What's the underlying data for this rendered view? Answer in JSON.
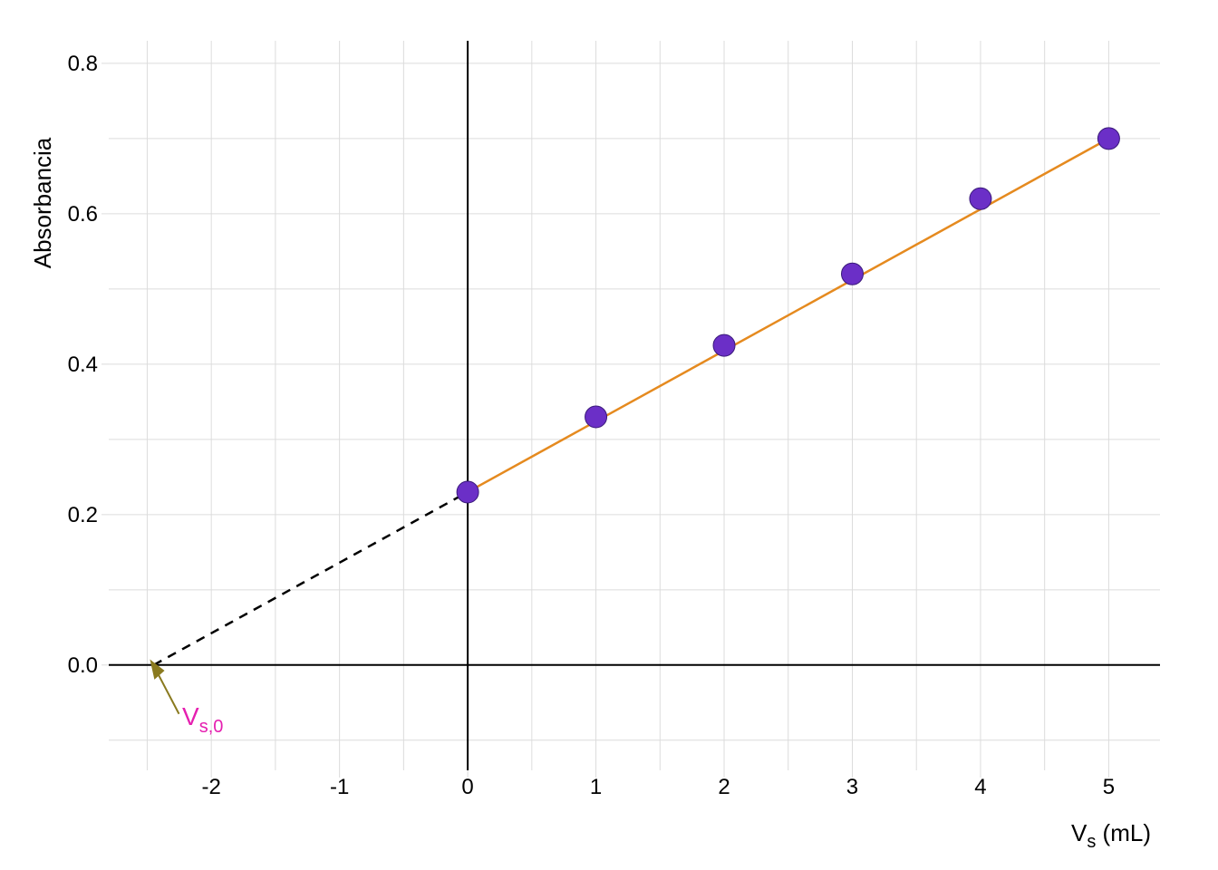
{
  "chart_data": {
    "type": "scatter",
    "title": "",
    "xlabel": "Vₛ  (mL)",
    "ylabel": "Absorbancia",
    "xlim": [
      -2.8,
      5.4
    ],
    "ylim": [
      -0.14,
      0.83
    ],
    "x_ticks": [
      -2,
      -1,
      0,
      1,
      2,
      3,
      4,
      5
    ],
    "y_ticks": [
      0.0,
      0.2,
      0.4,
      0.6,
      0.8
    ],
    "series": [
      {
        "name": "data",
        "x": [
          0,
          1,
          2,
          3,
          4,
          5
        ],
        "y": [
          0.23,
          0.33,
          0.425,
          0.52,
          0.62,
          0.7
        ]
      },
      {
        "name": "fit_line",
        "x": [
          0,
          5
        ],
        "y": [
          0.23,
          0.7
        ]
      },
      {
        "name": "extrapolation",
        "x": [
          -2.45,
          0
        ],
        "y": [
          0,
          0.23
        ]
      }
    ],
    "annotations": [
      {
        "id": "vs0",
        "text_main": "V",
        "text_sub": "s,0",
        "arrow_from": [
          -2.25,
          -0.065
        ],
        "arrow_to": [
          -2.42,
          -0.005
        ]
      }
    ],
    "colors": {
      "grid": "#dcdcdc",
      "point_fill": "#6b2fc7",
      "fit_line": "#e58a1f",
      "extrap": "#000000",
      "annotation_arrow": "#8a7a1f",
      "annotation_text": "#e51fb0"
    },
    "x_intercept": -2.45
  },
  "y_tick_labels": {
    "t0": "0.0",
    "t1": "0.2",
    "t2": "0.4",
    "t3": "0.6",
    "t4": "0.8"
  },
  "x_tick_labels": {
    "m2": "-2",
    "m1": "-1",
    "p0": "0",
    "p1": "1",
    "p2": "2",
    "p3": "3",
    "p4": "4",
    "p5": "5"
  },
  "labels": {
    "ylabel": "Absorbancia",
    "xlabel_pre": "V",
    "xlabel_sub": "s",
    "xlabel_post": "  (mL)",
    "annot_main": "V",
    "annot_sub": "s,0"
  }
}
